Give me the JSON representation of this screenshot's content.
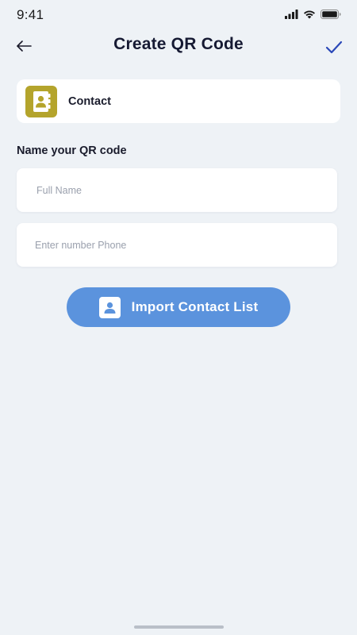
{
  "status_bar": {
    "time": "9:41",
    "icons": [
      "signal-icon",
      "wifi-icon",
      "battery-icon"
    ]
  },
  "nav": {
    "title": "Create QR Code",
    "back_icon": "arrow-left-icon",
    "confirm_icon": "checkmark-icon"
  },
  "qr_type": {
    "label": "Contact",
    "icon": "contact-book-icon",
    "icon_color": "#b4a42c"
  },
  "form": {
    "section_label": "Name your QR code",
    "full_name": {
      "placeholder": "Full Name",
      "value": ""
    },
    "phone": {
      "placeholder": "Enter number Phone",
      "value": ""
    }
  },
  "import_button": {
    "label": "Import Contact List",
    "icon": "contact-person-icon",
    "color": "#5b93dd"
  },
  "colors": {
    "background": "#eef2f6",
    "accent_check": "#2a48b8",
    "title_text": "#161a33"
  }
}
